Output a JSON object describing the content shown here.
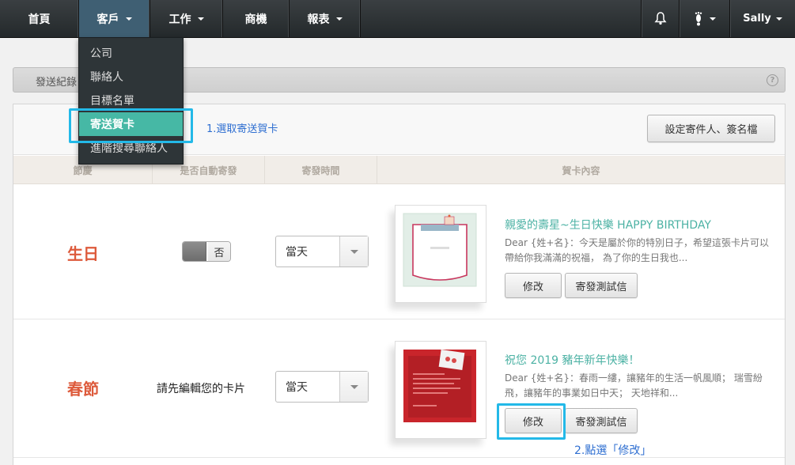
{
  "nav": {
    "items": [
      {
        "label": "首頁"
      },
      {
        "label": "客戶"
      },
      {
        "label": "工作"
      },
      {
        "label": "商機"
      },
      {
        "label": "報表"
      }
    ],
    "user": "Sally"
  },
  "dropdown": {
    "items": [
      {
        "label": "公司"
      },
      {
        "label": "聯絡人"
      },
      {
        "label": "目標名單"
      },
      {
        "label": "寄送賀卡"
      },
      {
        "label": "進階搜尋聯絡人"
      }
    ]
  },
  "header": {
    "title": "發送紀錄",
    "help": "?"
  },
  "toolbar": {
    "annotation1": "1.選取寄送賀卡",
    "sender_button": "設定寄件人、簽名檔"
  },
  "table": {
    "columns": [
      "節慶",
      "是否自動寄發",
      "寄發時間",
      "賀卡內容"
    ],
    "rows": [
      {
        "holiday": "生日",
        "auto_send": "否",
        "send_time": "當天",
        "card_title": "親愛的壽星~生日快樂 HAPPY BIRTHDAY",
        "card_desc": "Dear {姓+名}：今天是屬於你的特別日子，希望這張卡片可以帶給你我滿滿的祝福， 為了你的生日我也...",
        "edit_label": "修改",
        "test_label": "寄發測試信",
        "card_color": "#e6efe9"
      },
      {
        "holiday": "春節",
        "auto_note": "請先編輯您的卡片",
        "send_time": "當天",
        "card_title": "祝您 2019 豬年新年快樂！",
        "card_desc": "Dear {姓+名}：春雨一縷，讓豬年的生活一帆風順； 瑞雪紛飛，讓豬年的事業如日中天； 天地祥和...",
        "edit_label": "修改",
        "test_label": "寄發測試信",
        "card_color": "#c9252b"
      }
    ]
  },
  "annotation2": "2.點選「修改」",
  "colors": {
    "accent": "#46b8a5",
    "holiday_red": "#dd5a3b",
    "annot_box": "#23b9e8",
    "annot_text": "#2f6fd1"
  }
}
